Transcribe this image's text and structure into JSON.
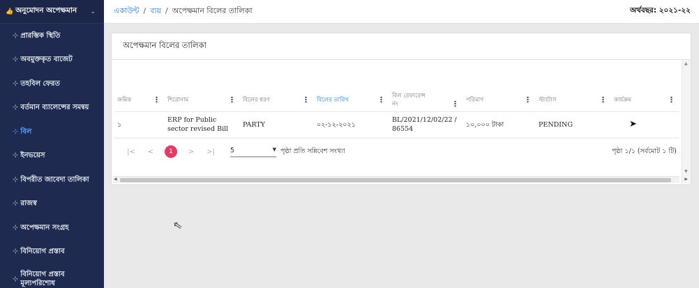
{
  "sidebar": {
    "header": {
      "icon": "thumbs-up-icon",
      "label": "অনুমোদন অপেক্ষমান"
    },
    "items": [
      {
        "label": "প্রারম্ভিক স্থিতি"
      },
      {
        "label": "অবমুক্তকৃত বাজেট"
      },
      {
        "label": "তহবিল ফেরত"
      },
      {
        "label": "বর্তমান ব্যালেন্সের সমন্বয়"
      },
      {
        "label": "বিল"
      },
      {
        "label": "ইনভয়েস"
      },
      {
        "label": "বিপরীত জাবেদা তালিকা"
      },
      {
        "label": "রাজস্ব"
      },
      {
        "label": "অপেক্ষমান সংগ্রহ"
      },
      {
        "label": "বিনিয়োগ প্রস্তাব"
      },
      {
        "label": "বিনিয়োগ প্রস্তাব মূল্যপরিশোধ"
      }
    ]
  },
  "breadcrumb": {
    "c1": "একাউন্ট",
    "c2": "ব্যয়",
    "c3": "অপেক্ষমান বিলের তালিকা"
  },
  "fiscal_year": "অর্থবছর: ২০২১-২২",
  "card": {
    "title": "অপেক্ষমান বিলের তালিকা"
  },
  "table": {
    "headers": [
      "ক্রমিক",
      "শিরোনাম",
      "বিলের ধরণ",
      "বিলের তারিখ",
      "বিল রেফারেন্স নং",
      "পরিমাণ",
      "স্ট্যাটাস",
      "কার্যক্রম"
    ],
    "rows": [
      {
        "serial": "১",
        "title": "ERP for Public sector revised Bill",
        "type": "PARTY",
        "date": "০২-১২-২০২১",
        "ref": "BL/2021/12/02/22 /86554",
        "amount": "১০,০০০ টাকা",
        "status": "PENDING",
        "action_icon": "send-icon"
      }
    ]
  },
  "pager": {
    "first": "|<",
    "prev": "<",
    "current": "1",
    "next": ">",
    "last": ">|",
    "per_page": "5",
    "per_page_label": "পৃষ্ঠা প্রতি সন্নিবেশ সংখ্যা",
    "info": "পৃষ্ঠা ১/১ (সর্বমোট ১ টি)"
  },
  "colors": {
    "sidebar_bg": "#1e2a4f",
    "active": "#5ea8ff",
    "link": "#1f7ae0",
    "page_badge": "#e63a63"
  }
}
